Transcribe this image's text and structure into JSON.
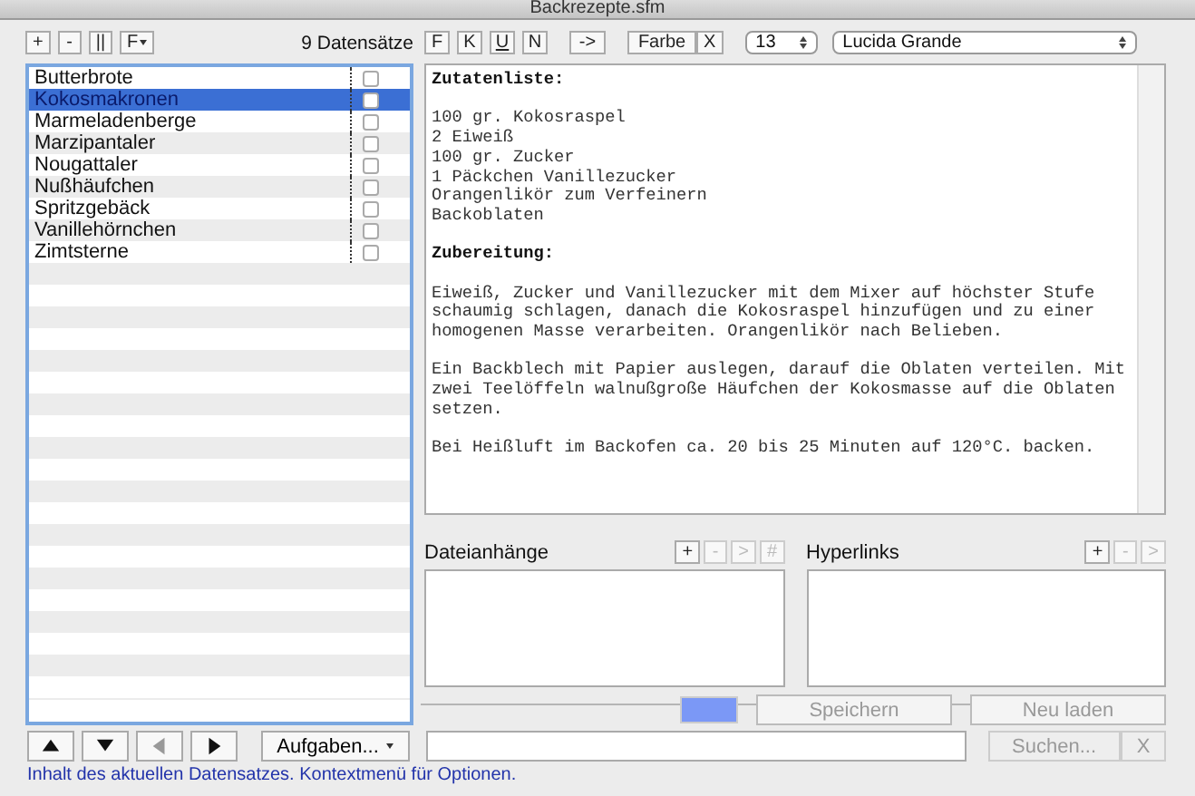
{
  "window": {
    "title": "Backrezepte.sfm"
  },
  "list_toolbar": {
    "buttons": [
      {
        "label": "+",
        "kind": "plain"
      },
      {
        "label": "-",
        "kind": "plain"
      },
      {
        "label": "||",
        "kind": "plain"
      },
      {
        "label": "F",
        "kind": "menu"
      }
    ],
    "count": "9 Datensätze"
  },
  "records": [
    {
      "name": "Butterbrote",
      "selected": false,
      "checked": false
    },
    {
      "name": "Kokosmakronen",
      "selected": true,
      "checked": false
    },
    {
      "name": "Marmeladenberge",
      "selected": false,
      "checked": false
    },
    {
      "name": "Marzipantaler",
      "selected": false,
      "checked": false
    },
    {
      "name": "Nougattaler",
      "selected": false,
      "checked": false
    },
    {
      "name": "Nußhäufchen",
      "selected": false,
      "checked": false
    },
    {
      "name": "Spritzgebäck",
      "selected": false,
      "checked": false
    },
    {
      "name": "Vanillehörnchen",
      "selected": false,
      "checked": false
    },
    {
      "name": "Zimtsterne",
      "selected": false,
      "checked": false
    }
  ],
  "format_toolbar": {
    "buttons": [
      {
        "label": "F",
        "kind": "plain"
      },
      {
        "label": "K",
        "kind": "plain"
      },
      {
        "label": "U",
        "kind": "underline"
      },
      {
        "label": "N",
        "kind": "plain"
      },
      {
        "label": "->",
        "kind": "plain"
      }
    ],
    "color_button": "Farbe",
    "clear_button": "X",
    "size": "13",
    "font": "Lucida Grande"
  },
  "editor": {
    "blocks": [
      {
        "kind": "heading",
        "text": "Zutatenliste:"
      },
      {
        "kind": "lines",
        "lines": [
          "100 gr. Kokosraspel",
          "2 Eiweiß",
          "100 gr. Zucker",
          "1 Päckchen Vanillezucker",
          "Orangenlikör zum Verfeinern",
          "Backoblaten"
        ]
      },
      {
        "kind": "heading",
        "text": "Zubereitung:"
      },
      {
        "kind": "paragraph",
        "text": "Eiweiß, Zucker und Vanillezucker mit dem Mixer auf höchster Stufe schaumig schlagen, danach die Kokosraspel hinzufügen und zu einer homogenen Masse verarbeiten. Orangenlikör nach Belieben."
      },
      {
        "kind": "paragraph",
        "text": "Ein Backblech mit Papier auslegen, darauf die Oblaten verteilen. Mit zwei Teelöffeln walnußgroße Häufchen der Kokosmasse auf die Oblaten setzen."
      },
      {
        "kind": "paragraph",
        "text": "Bei Heißluft im Backofen ca. 20 bis 25 Minuten auf 120°C. backen."
      }
    ]
  },
  "attachments": {
    "label": "Dateianhänge",
    "buttons": [
      {
        "label": "+",
        "disabled": false
      },
      {
        "label": "-",
        "disabled": true
      },
      {
        "label": ">",
        "disabled": true
      },
      {
        "label": "#",
        "disabled": true
      }
    ]
  },
  "hyperlinks": {
    "label": "Hyperlinks",
    "buttons": [
      {
        "label": "+",
        "disabled": false
      },
      {
        "label": "-",
        "disabled": true
      },
      {
        "label": ">",
        "disabled": true
      }
    ]
  },
  "save_button": {
    "label": "Speichern",
    "disabled": true
  },
  "reload_button": {
    "label": "Neu laden",
    "disabled": true
  },
  "nav_buttons": [
    {
      "kind": "up",
      "disabled": false
    },
    {
      "kind": "down",
      "disabled": false
    },
    {
      "kind": "left",
      "disabled": true
    },
    {
      "kind": "right",
      "disabled": false
    }
  ],
  "tasks_button": "Aufgaben...",
  "search": {
    "button": "Suchen...",
    "disabled": true,
    "clear": "X"
  },
  "status_bar": "Inhalt des aktuellen Datensatzes. Kontextmenü für Optionen."
}
